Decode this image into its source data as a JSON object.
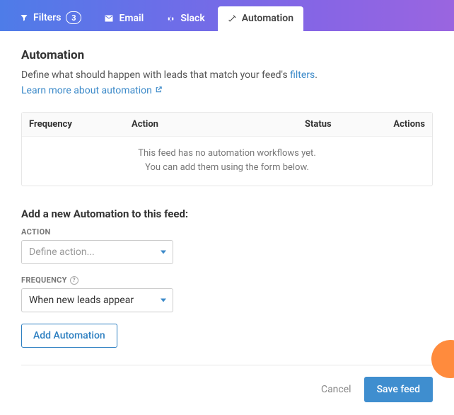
{
  "tabs": {
    "filters": {
      "label": "Filters",
      "count": "3"
    },
    "email": {
      "label": "Email"
    },
    "slack": {
      "label": "Slack"
    },
    "automation": {
      "label": "Automation"
    }
  },
  "page": {
    "heading": "Automation",
    "desc_before": "Define what should happen with leads that match your feed's ",
    "desc_link": "filters",
    "desc_after": ".",
    "learn_more": "Learn more about automation"
  },
  "table": {
    "headers": {
      "frequency": "Frequency",
      "action": "Action",
      "status": "Status",
      "actions": "Actions"
    },
    "empty1": "This feed has no automation workflows yet.",
    "empty2": "You can add them using the form below."
  },
  "form": {
    "title": "Add a new Automation to this feed:",
    "action_label": "ACTION",
    "action_placeholder": "Define action...",
    "frequency_label": "FREQUENCY",
    "frequency_value": "When new leads appear",
    "add_button": "Add Automation"
  },
  "footer": {
    "cancel": "Cancel",
    "save": "Save feed"
  }
}
